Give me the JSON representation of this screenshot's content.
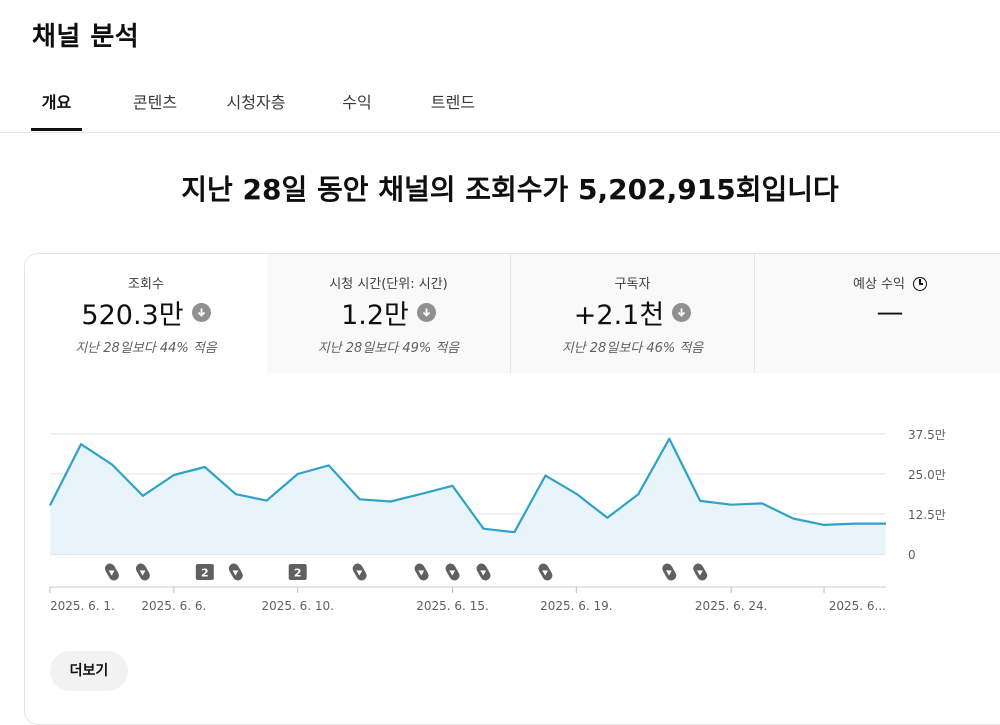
{
  "page": {
    "title": "채널 분석"
  },
  "tabs": [
    {
      "label": "개요",
      "active": true
    },
    {
      "label": "콘텐츠"
    },
    {
      "label": "시청자층"
    },
    {
      "label": "수익"
    },
    {
      "label": "트렌드"
    }
  ],
  "headline": "지난 28일 동안 채널의 조회수가 5,202,915회입니다",
  "metrics": [
    {
      "label": "조회수",
      "value": "520.3만",
      "delta": "지난 28일보다 44% 적음",
      "trend": "down"
    },
    {
      "label": "시청 시간(단위: 시간)",
      "value": "1.2만",
      "delta": "지난 28일보다 49% 적음",
      "trend": "down"
    },
    {
      "label": "구독자",
      "value": "+2.1천",
      "delta": "지난 28일보다 46% 적음",
      "trend": "down"
    },
    {
      "label": "예상 수익",
      "value": "—",
      "delta": "",
      "icon": "clock-icon"
    }
  ],
  "chart_data": {
    "type": "area",
    "series": [
      {
        "values": [
          152000,
          343000,
          280000,
          182000,
          247000,
          272000,
          187000,
          167000,
          250000,
          277000,
          171000,
          164000,
          188000,
          213000,
          79000,
          68000,
          245000,
          188000,
          113000,
          187000,
          360000,
          166000,
          154000,
          158000,
          111000,
          91000,
          95000,
          95000
        ]
      }
    ],
    "yticks": [
      "37.5만",
      "25.0만",
      "12.5만",
      "0"
    ],
    "ylim": [
      0,
      375000
    ],
    "xlabels": [
      "2025. 6. 1.",
      "2025. 6. 6.",
      "2025. 6. 10.",
      "2025. 6. 15.",
      "2025. 6. 19.",
      "2025. 6. 24.",
      "2025. 6..."
    ],
    "xlabel_days": [
      1,
      5,
      9,
      14,
      18,
      23,
      26
    ],
    "grid": true,
    "colors": {
      "line": "#2ea2c9",
      "fill": "#e8f4fa",
      "grid": "#e5e5e5",
      "marker": "#606060"
    },
    "markers": [
      {
        "day": 2,
        "kind": "shorts-icon"
      },
      {
        "day": 3,
        "kind": "shorts-icon"
      },
      {
        "day": 5,
        "kind": "badge",
        "label": "2"
      },
      {
        "day": 6,
        "kind": "shorts-icon"
      },
      {
        "day": 8,
        "kind": "badge",
        "label": "2"
      },
      {
        "day": 10,
        "kind": "shorts-icon"
      },
      {
        "day": 12,
        "kind": "shorts-icon"
      },
      {
        "day": 13,
        "kind": "shorts-icon"
      },
      {
        "day": 14,
        "kind": "shorts-icon"
      },
      {
        "day": 16,
        "kind": "shorts-icon"
      },
      {
        "day": 20,
        "kind": "shorts-icon"
      },
      {
        "day": 21,
        "kind": "shorts-icon"
      }
    ]
  },
  "more_button": "더보기"
}
